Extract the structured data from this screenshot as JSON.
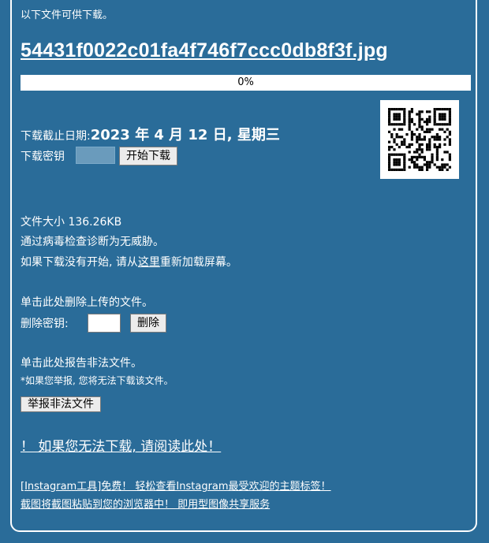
{
  "intro_text": "以下文件可供下载。",
  "file_name": "54431f0022c01fa4f746f7ccc0db8f3f.jpg",
  "progress": {
    "label": "0%",
    "value": 0
  },
  "deadline": {
    "label": "下载截止日期:",
    "date": "2023 年 4 月 12 日, 星期三"
  },
  "download_key": {
    "label": "下载密钥",
    "value": "",
    "start_button": "开始下载"
  },
  "file_info": {
    "size": "文件大小 136.26KB",
    "virus_check": "通过病毒检查诊断为无威胁。",
    "reload_prefix": "如果下载没有开始, 请从",
    "reload_link": "这里",
    "reload_suffix": "重新加载屏幕。"
  },
  "delete": {
    "title": "单击此处删除上传的文件。",
    "key_label": "删除密钥:",
    "key_value": "",
    "button": "删除"
  },
  "report": {
    "title": "单击此处报告非法文件。",
    "note": "*如果您举报, 您将无法下载该文件。",
    "button": "举报非法文件"
  },
  "cant_download_link": "！ 如果您无法下载, 请阅读此处！",
  "ads": {
    "line1": "[Instagram工具]免费！ 轻松查看Instagram最受欢迎的主题标签！",
    "line2": "截图将截图粘贴到您的浏览器中！ 即用型图像共享服务"
  },
  "icons": {
    "qr": "qr-code"
  },
  "colors": {
    "background": "#2a6c99",
    "text": "#ffffff",
    "progress_track": "#ffffff"
  }
}
